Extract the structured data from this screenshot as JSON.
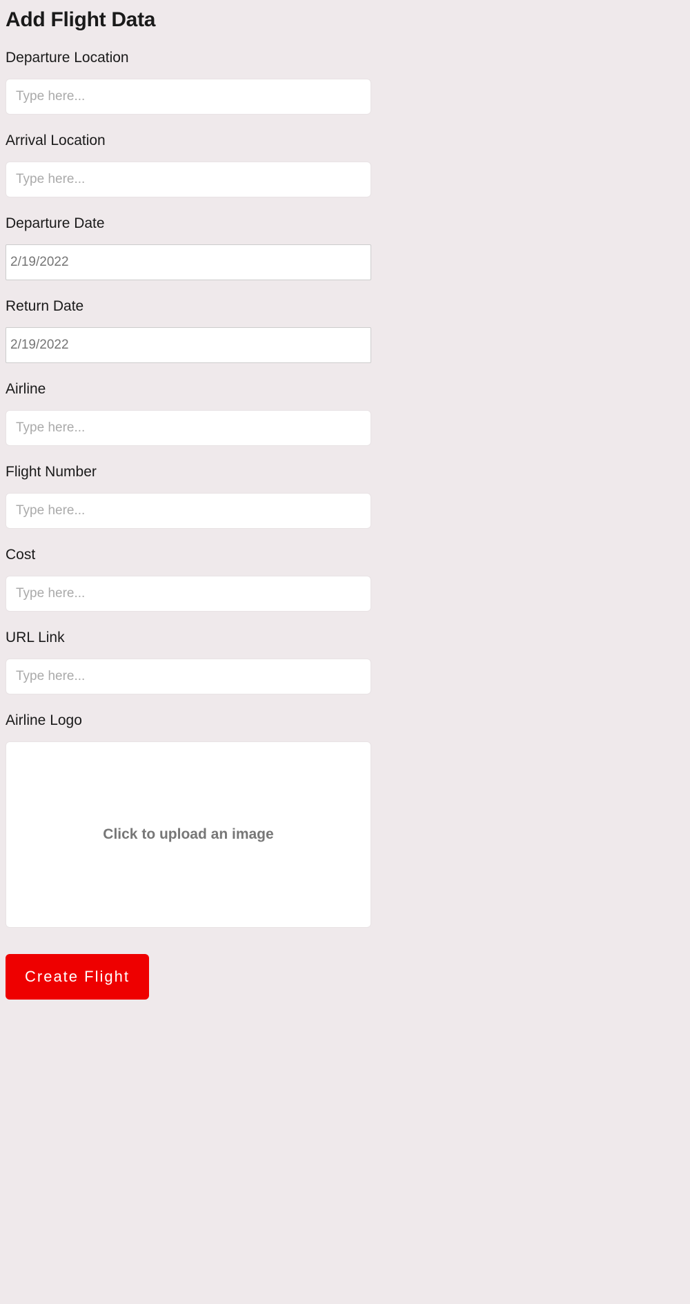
{
  "form": {
    "title": "Add Flight Data",
    "fields": {
      "departure_location": {
        "label": "Departure Location",
        "placeholder": "Type here...",
        "value": ""
      },
      "arrival_location": {
        "label": "Arrival Location",
        "placeholder": "Type here...",
        "value": ""
      },
      "departure_date": {
        "label": "Departure Date",
        "placeholder": "2/19/2022",
        "value": ""
      },
      "return_date": {
        "label": "Return Date",
        "placeholder": "2/19/2022",
        "value": ""
      },
      "airline": {
        "label": "Airline",
        "placeholder": "Type here...",
        "value": ""
      },
      "flight_number": {
        "label": "Flight Number",
        "placeholder": "Type here...",
        "value": ""
      },
      "cost": {
        "label": "Cost",
        "placeholder": "Type here...",
        "value": ""
      },
      "url_link": {
        "label": "URL Link",
        "placeholder": "Type here...",
        "value": ""
      },
      "airline_logo": {
        "label": "Airline Logo",
        "upload_text": "Click to upload an image"
      }
    },
    "submit_label": "Create Flight"
  }
}
